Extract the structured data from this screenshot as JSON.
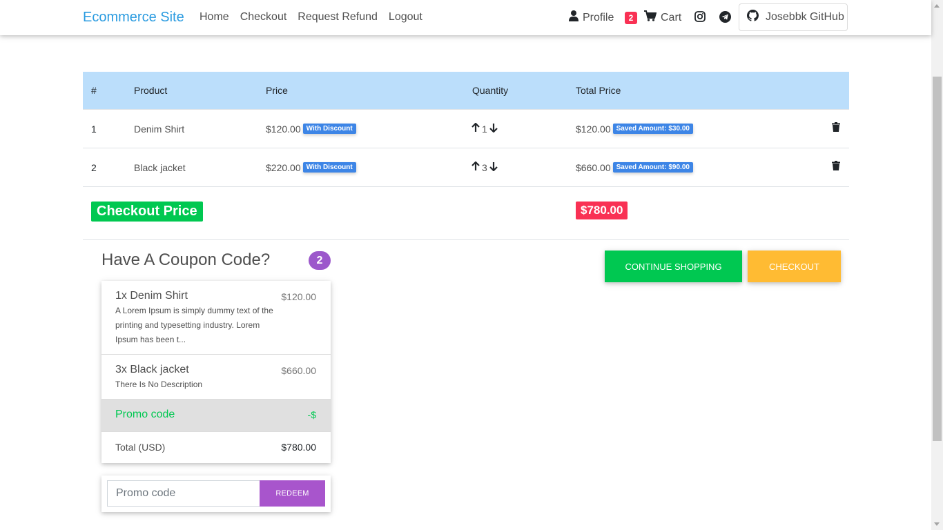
{
  "navbar": {
    "brand": "Ecommerce Site",
    "links": [
      "Home",
      "Checkout",
      "Request Refund",
      "Logout"
    ],
    "profile_label": "Profile",
    "cart_count": "2",
    "cart_label": "Cart",
    "github_label": "Josebbk GitHub"
  },
  "table": {
    "headers": [
      "#",
      "Product",
      "Price",
      "Quantity",
      "Total Price"
    ],
    "rows": [
      {
        "index": "1",
        "product": "Denim Shirt",
        "price": "$120.00",
        "discount_tag": "With Discount",
        "quantity": "1",
        "total": "$120.00",
        "saved_tag": "Saved Amount: $30.00"
      },
      {
        "index": "2",
        "product": "Black jacket",
        "price": "$220.00",
        "discount_tag": "With Discount",
        "quantity": "3",
        "total": "$660.00",
        "saved_tag": "Saved Amount: $90.00"
      }
    ],
    "checkout_label": "Checkout Price",
    "checkout_price": "$780.00"
  },
  "coupon": {
    "title": "Have A Coupon Code?",
    "count": "2",
    "items": [
      {
        "name": "1x Denim Shirt",
        "price": "$120.00",
        "description": "A Lorem Ipsum is simply dummy text of the printing and typesetting industry. Lorem Ipsum has been t..."
      },
      {
        "name": "3x Black jacket",
        "price": "$660.00",
        "description": "There Is No Description"
      }
    ],
    "promo_label": "Promo code",
    "promo_value": "-$",
    "total_label": "Total (USD)",
    "total_value": "$780.00",
    "input_placeholder": "Promo code",
    "redeem_label": "REDEEM"
  },
  "actions": {
    "continue_label": "CONTINUE SHOPPING",
    "checkout_label": "CHECKOUT"
  },
  "colors": {
    "brand": "#2a9be0",
    "table_header": "#bbdefb",
    "success": "#00c851",
    "danger": "#f93154",
    "warning": "#ffbb33",
    "secondary": "#a855cc",
    "info_tag": "#3d85e6"
  },
  "icons": [
    "user-icon",
    "cart-icon",
    "instagram-icon",
    "telegram-icon",
    "github-icon",
    "arrow-up-icon",
    "arrow-down-icon",
    "trash-icon"
  ]
}
